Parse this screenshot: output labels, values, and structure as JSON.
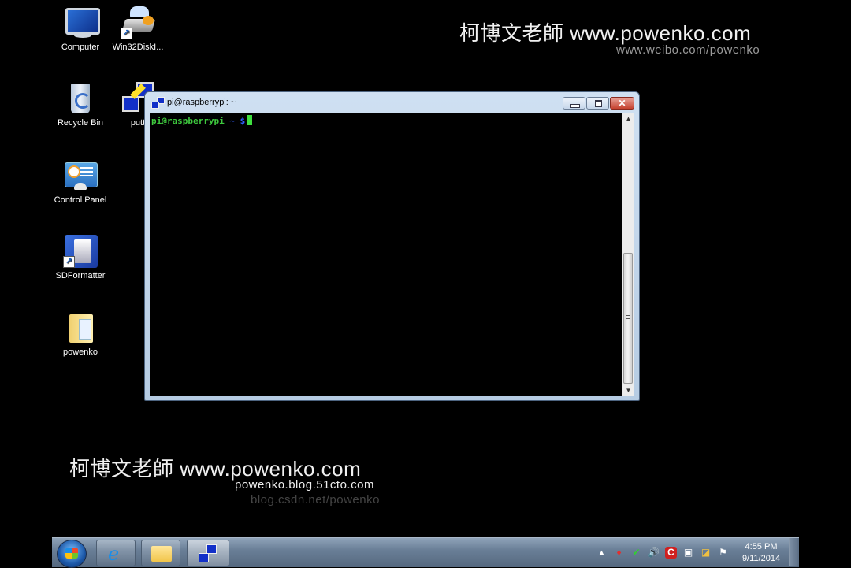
{
  "desktop": {
    "icons": [
      {
        "label": "Computer",
        "icon": "computer-icon"
      },
      {
        "label": "Win32DiskI...",
        "icon": "disk-imager-icon"
      },
      {
        "label": "Recycle Bin",
        "icon": "recycle-bin-icon"
      },
      {
        "label": "putt",
        "icon": "putty-icon"
      },
      {
        "label": "Control Panel",
        "icon": "control-panel-icon"
      },
      {
        "label": "SDFormatter",
        "icon": "sdformatter-icon"
      },
      {
        "label": "powenko",
        "icon": "folder-icon"
      }
    ]
  },
  "watermark": {
    "top_main": "柯博文老師 www.powenko.com",
    "top_sub": "www.weibo.com/powenko",
    "bottom_main": "柯博文老師 www.powenko.com",
    "bottom_sub1": "powenko.blog.51cto.com",
    "bottom_sub2": "blog.csdn.net/powenko"
  },
  "putty_window": {
    "title": "pi@raspberrypi: ~",
    "buttons": {
      "minimize": "minimize",
      "maximize": "maximize",
      "close": "✕"
    },
    "terminal": {
      "prompt_user": "pi@raspberrypi",
      "prompt_path": " ~ $",
      "command": ""
    },
    "scrollbar": {
      "up": "▲",
      "down": "▼"
    }
  },
  "taskbar": {
    "pinned": [
      "Internet Explorer",
      "Windows Explorer",
      "PuTTY"
    ],
    "tray_icons": [
      "show-hidden-icons",
      "fox-icon",
      "usb-safe-remove-icon",
      "volume-icon",
      "security-icon",
      "network-icon",
      "windows-update-icon",
      "action-center-flag-icon"
    ],
    "tray_arrow": "▲",
    "clock": {
      "time": "4:55 PM",
      "date": "9/11/2014"
    }
  }
}
